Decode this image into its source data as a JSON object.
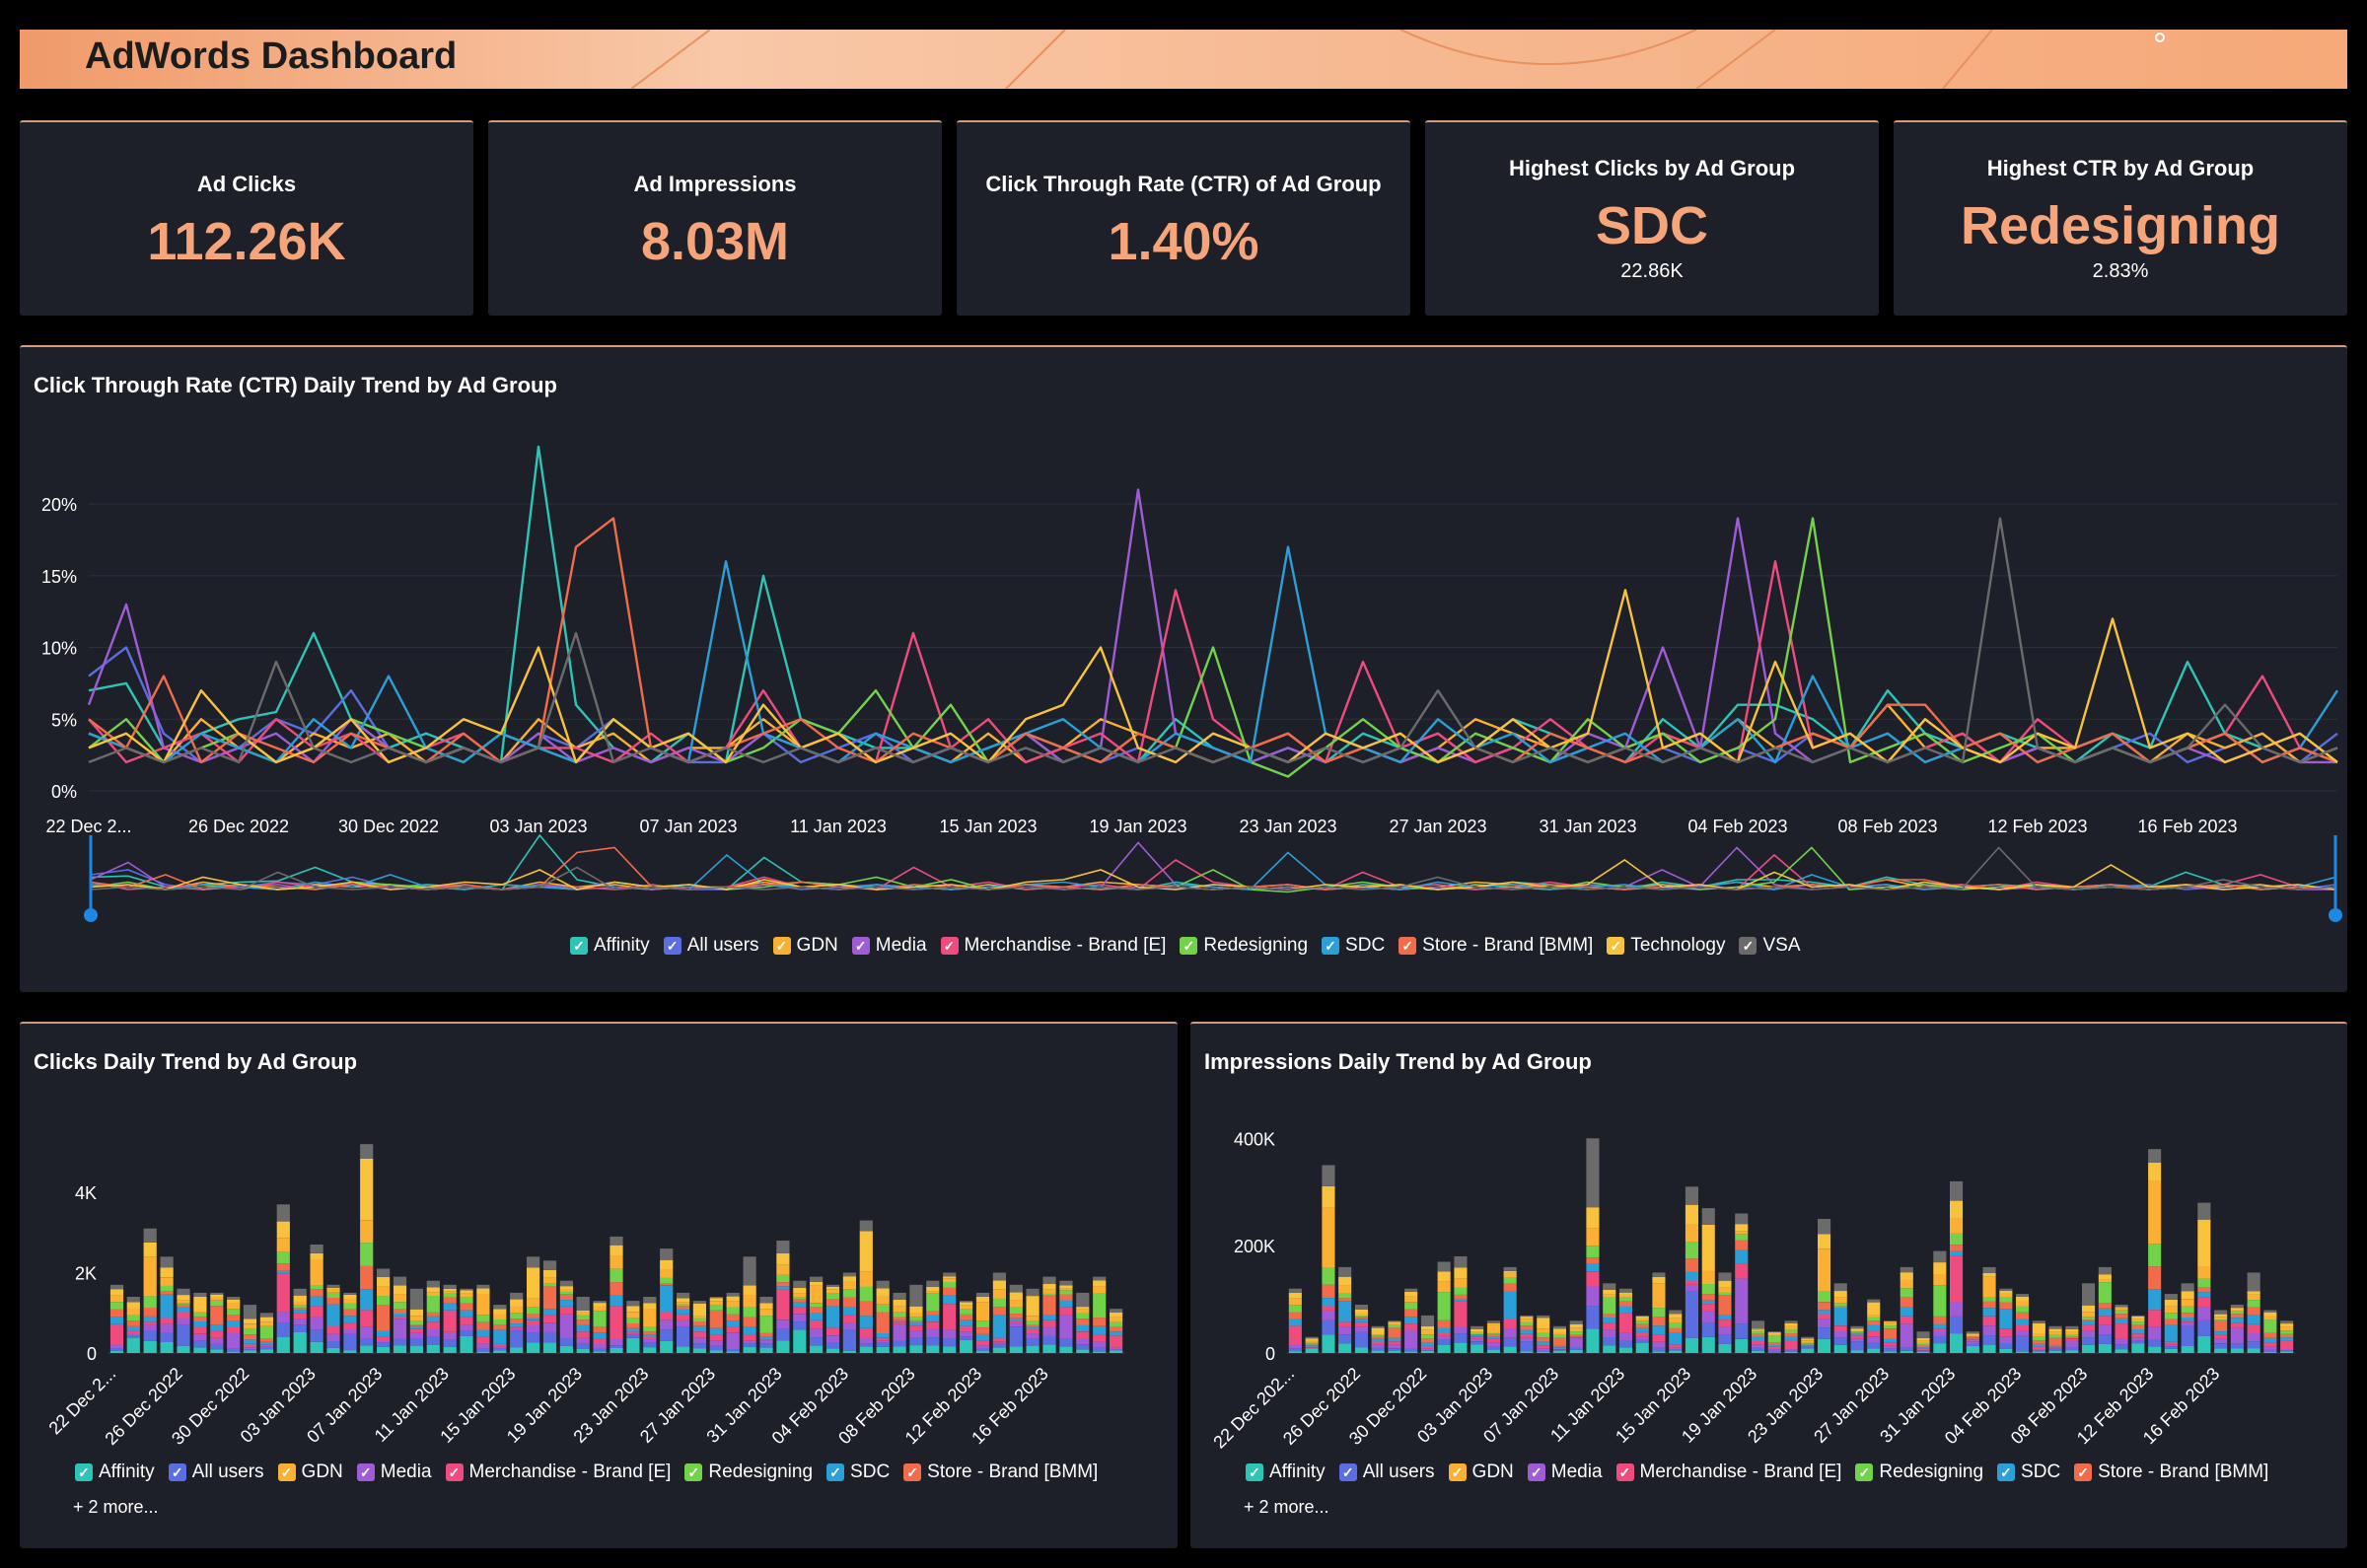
{
  "header": {
    "title": "AdWords Dashboard"
  },
  "kpis": [
    {
      "label": "Ad Clicks",
      "value": "112.26K"
    },
    {
      "label": "Ad Impressions",
      "value": "8.03M"
    },
    {
      "label": "Click Through Rate (CTR) of Ad Group",
      "value": "1.40%"
    },
    {
      "label": "Highest Clicks by Ad Group",
      "value": "SDC",
      "sub": "22.86K"
    },
    {
      "label": "Highest CTR by Ad Group",
      "value": "Redesigning",
      "sub": "2.83%"
    }
  ],
  "colors": {
    "accent": "#f6a47a",
    "panel": "#1d2029",
    "series": {
      "Affinity": "#2ec4b6",
      "All users": "#5b6ee1",
      "GDN": "#fbb034",
      "Media": "#a05cd6",
      "Merchandise - Brand [E]": "#ef4b7f",
      "Redesigning": "#72d24a",
      "SDC": "#2a9fd8",
      "Store - Brand [BMM]": "#f26b4a",
      "Technology": "#f9c23c",
      "VSA": "#6b6b6b"
    }
  },
  "legend_check": "✓",
  "more_label": "+ 2 more...",
  "chart_data": [
    {
      "id": "ctr",
      "type": "line",
      "title": "Click Through Rate (CTR) Daily Trend by Ad Group",
      "x_tick_labels": [
        "22 Dec 2...",
        "26 Dec 2022",
        "30 Dec 2022",
        "03 Jan 2023",
        "07 Jan 2023",
        "11 Jan 2023",
        "15 Jan 2023",
        "19 Jan 2023",
        "23 Jan 2023",
        "27 Jan 2023",
        "31 Jan 2023",
        "04 Feb 2023",
        "08 Feb 2023",
        "12 Feb 2023",
        "16 Feb 2023"
      ],
      "y_tick_labels": [
        "0%",
        "5%",
        "10%",
        "15%",
        "20%"
      ],
      "ylim": [
        0,
        22
      ],
      "num_days": 61,
      "legend": [
        "Affinity",
        "All users",
        "GDN",
        "Media",
        "Merchandise - Brand [E]",
        "Redesigning",
        "SDC",
        "Store - Brand [BMM]",
        "Technology",
        "VSA"
      ],
      "series": [
        {
          "name": "Affinity",
          "values": [
            7,
            7.5,
            3,
            4,
            5,
            5.5,
            11,
            5,
            3,
            4,
            3,
            2,
            24,
            6,
            3,
            2,
            4,
            2,
            15,
            5,
            4,
            3,
            3,
            2,
            3,
            4,
            2,
            3,
            2,
            5,
            3,
            2,
            3,
            2,
            4,
            3,
            2,
            3,
            5,
            4,
            3,
            2,
            5,
            3,
            6,
            6,
            5,
            3,
            7,
            4,
            3,
            4,
            3,
            2,
            4,
            3,
            9,
            4,
            3,
            4,
            2
          ]
        },
        {
          "name": "All users",
          "values": [
            8,
            10,
            4,
            2,
            3,
            5,
            4,
            7,
            3,
            2,
            3,
            2,
            4,
            3,
            5,
            3,
            2,
            2,
            4,
            2,
            3,
            4,
            2,
            3,
            2,
            4,
            3,
            2,
            3,
            2,
            4,
            3,
            2,
            3,
            2,
            3,
            4,
            2,
            3,
            2,
            3,
            2,
            3,
            2,
            3,
            2,
            4,
            3,
            2,
            5,
            3,
            2,
            3,
            2,
            3,
            4,
            2,
            3,
            4,
            2,
            4
          ]
        },
        {
          "name": "GDN",
          "values": [
            4,
            3,
            2,
            5,
            3,
            2,
            4,
            3,
            4,
            2,
            3,
            2,
            5,
            3,
            4,
            2,
            3,
            3,
            5,
            3,
            4,
            2,
            3,
            2,
            4,
            2,
            3,
            5,
            4,
            3,
            2,
            3,
            4,
            2,
            3,
            2,
            3,
            5,
            4,
            3,
            2,
            3,
            4,
            3,
            5,
            3,
            4,
            3,
            6,
            3,
            4,
            2,
            3,
            3,
            4,
            2,
            4,
            3,
            4,
            2,
            3
          ]
        },
        {
          "name": "Media",
          "values": [
            6,
            13,
            3,
            2,
            3,
            4,
            2,
            5,
            3,
            2,
            3,
            2,
            4,
            2,
            3,
            2,
            3,
            2,
            4,
            3,
            2,
            3,
            2,
            3,
            2,
            4,
            2,
            3,
            21,
            4,
            3,
            2,
            3,
            2,
            3,
            2,
            3,
            2,
            3,
            2,
            4,
            3,
            10,
            3,
            19,
            4,
            2,
            3,
            4,
            2,
            3,
            2,
            3,
            2,
            3,
            2,
            3,
            2,
            3,
            2,
            2
          ]
        },
        {
          "name": "Merchandise - Brand [E]",
          "values": [
            5,
            2,
            3,
            4,
            2,
            5,
            3,
            4,
            2,
            3,
            4,
            2,
            3,
            3,
            2,
            4,
            2,
            3,
            7,
            3,
            4,
            2,
            11,
            3,
            5,
            2,
            3,
            4,
            2,
            14,
            5,
            3,
            4,
            2,
            9,
            3,
            4,
            2,
            3,
            5,
            3,
            2,
            4,
            3,
            2,
            16,
            3,
            4,
            2,
            3,
            4,
            2,
            5,
            3,
            4,
            2,
            3,
            4,
            8,
            3,
            2
          ]
        },
        {
          "name": "Redesigning",
          "values": [
            3,
            5,
            2,
            3,
            4,
            2,
            3,
            5,
            4,
            3,
            2,
            4,
            3,
            2,
            5,
            3,
            4,
            2,
            3,
            5,
            4,
            7,
            3,
            6,
            2,
            4,
            3,
            2,
            4,
            3,
            10,
            2,
            1,
            3,
            5,
            3,
            2,
            4,
            3,
            2,
            5,
            3,
            4,
            2,
            3,
            5,
            19,
            2,
            3,
            4,
            2,
            3,
            4,
            2,
            3,
            2,
            3,
            4,
            2,
            3,
            2
          ]
        },
        {
          "name": "SDC",
          "values": [
            4,
            3,
            2,
            4,
            3,
            2,
            5,
            3,
            8,
            3,
            2,
            4,
            3,
            2,
            5,
            3,
            2,
            16,
            4,
            3,
            2,
            4,
            3,
            2,
            3,
            4,
            5,
            3,
            2,
            4,
            3,
            2,
            17,
            4,
            3,
            2,
            5,
            3,
            4,
            2,
            3,
            4,
            2,
            3,
            5,
            2,
            8,
            3,
            4,
            2,
            3,
            4,
            2,
            3,
            4,
            2,
            3,
            4,
            2,
            3,
            7
          ]
        },
        {
          "name": "Store - Brand [BMM]",
          "values": [
            5,
            3,
            8,
            2,
            4,
            3,
            2,
            4,
            3,
            2,
            4,
            2,
            3,
            17,
            19,
            3,
            2,
            3,
            4,
            5,
            3,
            2,
            4,
            3,
            2,
            4,
            3,
            2,
            4,
            3,
            2,
            3,
            4,
            2,
            3,
            4,
            2,
            3,
            2,
            4,
            3,
            2,
            3,
            4,
            2,
            3,
            4,
            3,
            6,
            6,
            3,
            4,
            2,
            3,
            4,
            2,
            3,
            4,
            2,
            3,
            2
          ]
        },
        {
          "name": "Technology",
          "values": [
            3,
            4,
            2,
            7,
            4,
            2,
            3,
            5,
            2,
            3,
            5,
            4,
            10,
            2,
            5,
            3,
            4,
            2,
            6,
            3,
            4,
            2,
            3,
            4,
            2,
            5,
            6,
            10,
            3,
            2,
            4,
            3,
            2,
            4,
            3,
            4,
            2,
            3,
            5,
            3,
            4,
            14,
            3,
            4,
            2,
            9,
            3,
            4,
            2,
            5,
            3,
            2,
            4,
            3,
            12,
            3,
            4,
            2,
            3,
            4,
            2
          ]
        },
        {
          "name": "VSA",
          "values": [
            2,
            3,
            2,
            3,
            2,
            9,
            3,
            2,
            3,
            2,
            3,
            2,
            3,
            11,
            2,
            3,
            2,
            3,
            2,
            3,
            2,
            3,
            2,
            3,
            2,
            3,
            2,
            3,
            2,
            3,
            2,
            3,
            2,
            3,
            2,
            3,
            7,
            3,
            2,
            3,
            2,
            3,
            2,
            3,
            2,
            3,
            2,
            3,
            2,
            3,
            2,
            19,
            3,
            2,
            3,
            2,
            3,
            6,
            3,
            2,
            3
          ]
        }
      ]
    },
    {
      "id": "clicks",
      "type": "bar",
      "stacked": true,
      "title": "Clicks Daily Trend by Ad Group",
      "x_tick_labels": [
        "22 Dec 2...",
        "26 Dec 2022",
        "30 Dec 2022",
        "03 Jan 2023",
        "07 Jan 2023",
        "11 Jan 2023",
        "15 Jan 2023",
        "19 Jan 2023",
        "23 Jan 2023",
        "27 Jan 2023",
        "31 Jan 2023",
        "04 Feb 2023",
        "08 Feb 2023",
        "12 Feb 2023",
        "16 Feb 2023"
      ],
      "y_tick_labels": [
        "0",
        "2K",
        "4K"
      ],
      "ylim": [
        0,
        5500
      ],
      "legend": [
        "Affinity",
        "All users",
        "GDN",
        "Media",
        "Merchandise - Brand [E]",
        "Redesigning",
        "SDC",
        "Store - Brand [BMM]"
      ],
      "totals": [
        1700,
        1400,
        3100,
        2400,
        1600,
        1500,
        1500,
        1400,
        1200,
        1000,
        3700,
        1600,
        2700,
        1700,
        1500,
        5200,
        2100,
        1900,
        1600,
        1800,
        1700,
        1600,
        1700,
        1200,
        1500,
        2400,
        2300,
        1800,
        1400,
        1300,
        2900,
        1300,
        1400,
        2600,
        1500,
        1300,
        1400,
        1500,
        2400,
        1400,
        2800,
        1800,
        1900,
        1700,
        2000,
        3300,
        1800,
        1500,
        1700,
        1800,
        2000,
        1300,
        1500,
        2000,
        1700,
        1600,
        1900,
        1800,
        1500,
        1900,
        1100
      ]
    },
    {
      "id": "impressions",
      "type": "bar",
      "stacked": true,
      "title": "Impressions Daily Trend by Ad Group",
      "x_tick_labels": [
        "22 Dec 202...",
        "26 Dec 2022",
        "30 Dec 2022",
        "03 Jan 2023",
        "07 Jan 2023",
        "11 Jan 2023",
        "15 Jan 2023",
        "19 Jan 2023",
        "23 Jan 2023",
        "27 Jan 2023",
        "31 Jan 2023",
        "04 Feb 2023",
        "08 Feb 2023",
        "12 Feb 2023",
        "16 Feb 2023"
      ],
      "y_tick_labels": [
        "0",
        "200K",
        "400K"
      ],
      "ylim": [
        0,
        430000
      ],
      "legend": [
        "Affinity",
        "All users",
        "GDN",
        "Media",
        "Merchandise - Brand [E]",
        "Redesigning",
        "SDC",
        "Store - Brand [BMM]"
      ],
      "totals": [
        120000,
        30000,
        350000,
        160000,
        90000,
        50000,
        60000,
        120000,
        70000,
        170000,
        180000,
        50000,
        60000,
        160000,
        70000,
        70000,
        50000,
        60000,
        400000,
        130000,
        120000,
        70000,
        150000,
        80000,
        310000,
        270000,
        150000,
        260000,
        60000,
        40000,
        60000,
        30000,
        250000,
        130000,
        50000,
        100000,
        60000,
        160000,
        40000,
        190000,
        320000,
        40000,
        160000,
        120000,
        110000,
        60000,
        50000,
        50000,
        130000,
        160000,
        90000,
        70000,
        380000,
        110000,
        130000,
        280000,
        80000,
        90000,
        150000,
        80000,
        60000
      ]
    }
  ]
}
